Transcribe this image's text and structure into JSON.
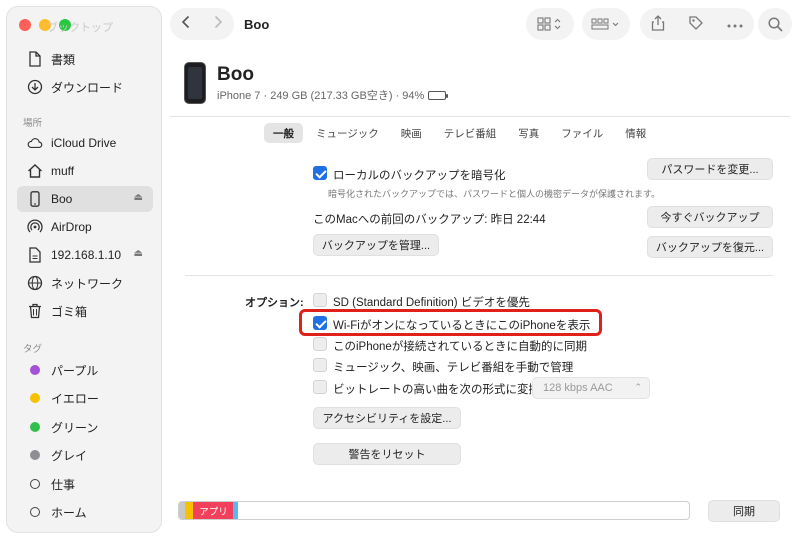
{
  "sidebar": {
    "faded_title": "ブックトップ",
    "favorites": [
      {
        "label": "書類",
        "icon": "document-icon"
      },
      {
        "label": "ダウンロード",
        "icon": "download-icon"
      }
    ],
    "locations_header": "場所",
    "locations": [
      {
        "label": "iCloud Drive",
        "icon": "cloud-icon"
      },
      {
        "label": "muff",
        "icon": "home-icon"
      },
      {
        "label": "Boo",
        "icon": "iphone-icon",
        "selected": true,
        "eject": true
      },
      {
        "label": "AirDrop",
        "icon": "airdrop-icon"
      },
      {
        "label": "192.168.1.10",
        "icon": "server-icon",
        "eject": true
      },
      {
        "label": "ネットワーク",
        "icon": "network-icon"
      },
      {
        "label": "ゴミ箱",
        "icon": "trash-icon"
      }
    ],
    "tags_header": "タグ",
    "tags": [
      {
        "label": "パープル",
        "color": "#a550d6"
      },
      {
        "label": "イエロー",
        "color": "#f7c100"
      },
      {
        "label": "グリーン",
        "color": "#2fbf4a"
      },
      {
        "label": "グレイ",
        "color": "#8e8e93"
      },
      {
        "label": "仕事",
        "color": ""
      },
      {
        "label": "ホーム",
        "color": ""
      }
    ]
  },
  "toolbar": {
    "title": "Boo"
  },
  "device": {
    "name": "Boo",
    "info": "iPhone 7 · 249 GB (217.33 GB空き) · 94%",
    "battery_level": 0.94
  },
  "tabs": [
    "一般",
    "ミュージック",
    "映画",
    "テレビ番組",
    "写真",
    "ファイル",
    "情報"
  ],
  "backup": {
    "encrypt_label": "ローカルのバックアップを暗号化",
    "encrypt_note": "暗号化されたバックアップでは、パスワードと個人の機密データが保護されます。",
    "change_password": "パスワードを変更...",
    "last_backup": "このMacへの前回のバックアップ: 昨日 22:44",
    "backup_now": "今すぐバックアップ",
    "manage_backups": "バックアップを管理...",
    "restore_backup": "バックアップを復元..."
  },
  "options": {
    "label": "オプション:",
    "items": [
      {
        "label": "SD (Standard Definition) ビデオを優先",
        "checked": false
      },
      {
        "label": "Wi-FiがオンになっているときにこのiPhoneを表示",
        "checked": true
      },
      {
        "label": "このiPhoneが接続されているときに自動的に同期",
        "checked": false
      },
      {
        "label": "ミュージック、映画、テレビ番組を手動で管理",
        "checked": false
      },
      {
        "label": "ビットレートの高い曲を次の形式に変換:",
        "checked": false
      }
    ],
    "bitrate_value": "128 kbps AAC",
    "accessibility_button": "アクセシビリティを設定...",
    "reset_warnings": "警告をリセット"
  },
  "storage": {
    "apps_label": "アプリ",
    "sync_button": "同期",
    "segments": [
      {
        "name": "",
        "color": "#c8c8c8",
        "fraction": 0.012
      },
      {
        "name": "",
        "color": "#f7c100",
        "fraction": 0.016
      },
      {
        "name": "アプリ",
        "color": "#f0405c",
        "fraction": 0.078
      },
      {
        "name": "",
        "color": "#5ab8f0",
        "fraction": 0.01
      }
    ]
  }
}
